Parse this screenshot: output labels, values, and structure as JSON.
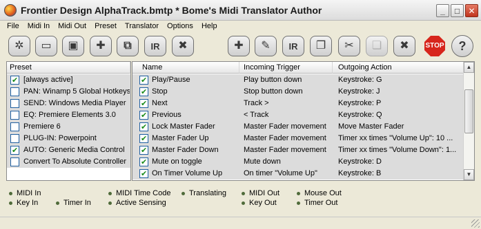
{
  "window": {
    "title": "Frontier Design AlphaTrack.bmtp * Bome's Midi Translator Author",
    "controls": {
      "minimize": "_",
      "maximize": "□",
      "close": "✕"
    }
  },
  "menu": [
    "File",
    "Midi In",
    "Midi Out",
    "Preset",
    "Translator",
    "Options",
    "Help"
  ],
  "toolbar": {
    "left": [
      {
        "icon": "puzzle-icon",
        "glyph": "✲"
      },
      {
        "icon": "open-folder-icon",
        "glyph": "▭"
      },
      {
        "icon": "save-icon",
        "glyph": "▣"
      },
      {
        "icon": "add-preset-icon",
        "glyph": "✚"
      },
      {
        "icon": "duplicate-preset-icon",
        "glyph": "⧉"
      },
      {
        "icon": "rename-preset-icon",
        "glyph": "IR"
      },
      {
        "icon": "delete-preset-icon",
        "glyph": "✖"
      }
    ],
    "right": [
      {
        "icon": "add-translator-icon",
        "glyph": "✚"
      },
      {
        "icon": "edit-translator-icon",
        "glyph": "✎"
      },
      {
        "icon": "rename-translator-icon",
        "glyph": "IR"
      },
      {
        "icon": "copy-translator-icon",
        "glyph": "❐"
      },
      {
        "icon": "cut-translator-icon",
        "glyph": "✂"
      },
      {
        "icon": "paste-translator-icon",
        "glyph": "❏"
      },
      {
        "icon": "delete-translator-icon",
        "glyph": "✖"
      }
    ],
    "stop_label": "STOP",
    "help_glyph": "?"
  },
  "presets": {
    "header": "Preset",
    "items": [
      {
        "label": "[always active]",
        "checked": true
      },
      {
        "label": "PAN: Winamp 5 Global Hotkeys",
        "checked": false
      },
      {
        "label": "SEND: Windows Media Player",
        "checked": false
      },
      {
        "label": "EQ: Premiere Elements 3.0",
        "checked": false
      },
      {
        "label": "Premiere 6",
        "checked": false
      },
      {
        "label": "PLUG-IN: Powerpoint",
        "checked": false
      },
      {
        "label": "AUTO: Generic Media Control",
        "checked": true
      },
      {
        "label": "Convert To Absolute Controller",
        "checked": false
      }
    ]
  },
  "translators": {
    "headers": {
      "name": "Name",
      "trigger": "Incoming Trigger",
      "action": "Outgoing Action"
    },
    "rows": [
      {
        "name": "Play/Pause",
        "trigger": "Play button down",
        "action": "Keystroke: G",
        "checked": true
      },
      {
        "name": "Stop",
        "trigger": "Stop button down",
        "action": "Keystroke: J",
        "checked": true
      },
      {
        "name": "Next",
        "trigger": "Track >",
        "action": "Keystroke: P",
        "checked": true
      },
      {
        "name": "Previous",
        "trigger": "< Track",
        "action": "Keystroke: Q",
        "checked": true
      },
      {
        "name": "Lock Master Fader",
        "trigger": "Master Fader movement",
        "action": "Move Master Fader",
        "checked": true
      },
      {
        "name": "Master Fader Up",
        "trigger": "Master Fader movement",
        "action": "Timer xx times \"Volume Up\": 10 ...",
        "checked": true
      },
      {
        "name": "Master Fader Down",
        "trigger": "Master Fader movement",
        "action": "Timer xx times \"Volume Down\": 1...",
        "checked": true
      },
      {
        "name": "Mute on toggle",
        "trigger": "Mute down",
        "action": "Keystroke: D",
        "checked": true
      },
      {
        "name": "On Timer Volume Up",
        "trigger": "On timer \"Volume Up\"",
        "action": "Keystroke: B",
        "checked": true
      }
    ]
  },
  "indicators": {
    "midi_in": "MIDI In",
    "key_in": "Key In",
    "timer_in": "Timer In",
    "midi_time_code": "MIDI Time Code",
    "active_sensing": "Active Sensing",
    "translating": "Translating",
    "midi_out": "MIDI Out",
    "key_out": "Key Out",
    "mouse_out": "Mouse Out",
    "timer_out": "Timer Out"
  },
  "colors": {
    "accent_check": "#1a8a1a",
    "stop_red": "#d7261c",
    "row_bg": "#dcdcdc"
  }
}
